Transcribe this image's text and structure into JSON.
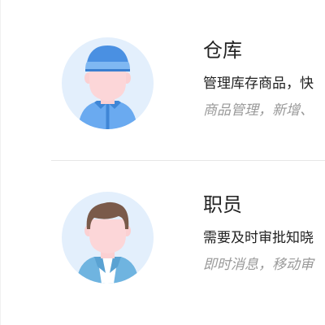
{
  "roles": [
    {
      "title": "仓库",
      "description": "管理库存商品，快",
      "features": "商品管理，新增、",
      "avatar_icon": "warehouse-worker-icon"
    },
    {
      "title": "职员",
      "description": "需要及时审批知晓",
      "features": "即时消息，移动审",
      "avatar_icon": "staff-member-icon"
    }
  ],
  "colors": {
    "title_text": "#222222",
    "description_text": "#222222",
    "features_text": "#9a9a9a",
    "avatar_bg": "#e3effc",
    "divider": "#e6e6e6"
  }
}
